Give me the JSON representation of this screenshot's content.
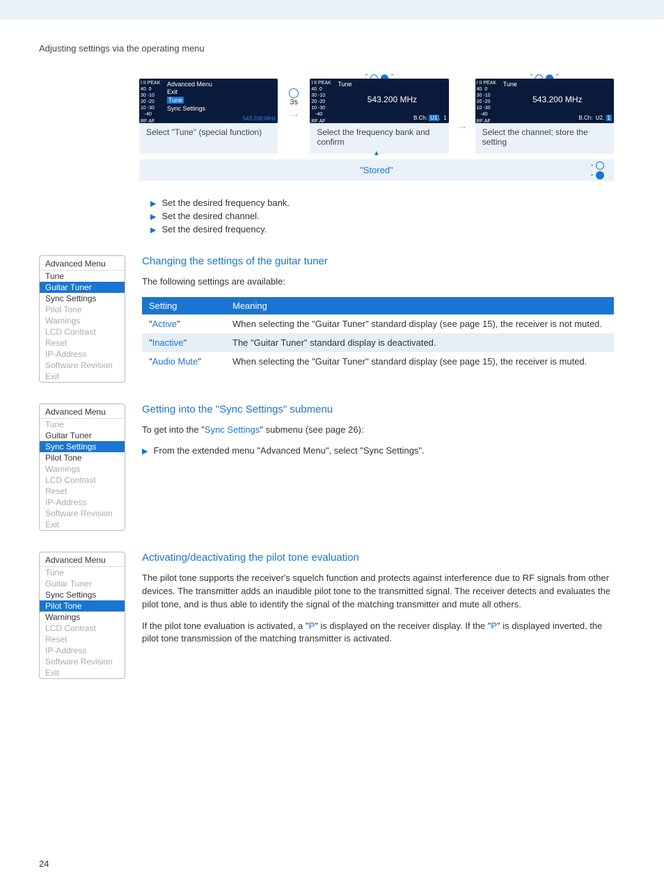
{
  "page_title": "Adjusting settings via the operating menu",
  "page_number": "24",
  "diagram": {
    "lcd1": {
      "title": "Advanced Menu",
      "r1": "Exit",
      "r2": "Tune",
      "r3": "Sync Settings",
      "freq": "543.200 MHz"
    },
    "lcd2": {
      "title": "Tune",
      "freq": "543.200 MHz",
      "bch": "B.Ch: U1.  1"
    },
    "lcd3": {
      "title": "Tune",
      "freq": "543.200 MHz",
      "bch": "B.Ch:  U2. 1"
    },
    "timer": "3s",
    "cap1": "Select \"Tune\" (special function)",
    "cap2": "Select the frequency bank and confirm",
    "cap3": "Select the channel; store the setting",
    "stored": "\"Stored\"",
    "meter_lines": [
      "I  II  PEAK",
      "40   0",
      "30  -10",
      "20  -20",
      "10  -30",
      "     -40",
      "RF | AF"
    ]
  },
  "bullets": [
    "Set the desired frequency bank.",
    "Set the desired channel.",
    "Set the desired frequency."
  ],
  "section1": {
    "heading": "Changing the settings of the guitar tuner",
    "intro": "The following settings are available:",
    "menu_title": "Advanced Menu",
    "menu_items": [
      "Tune",
      "Guitar Tuner",
      "Sync Settings",
      "Pilot Tone",
      "Warnings",
      "LCD Contrast",
      "Reset",
      "IP-Address",
      "Software Revision",
      "Exit"
    ],
    "menu_selected_index": 1,
    "menu_dark": [
      0,
      2
    ],
    "th1": "Setting",
    "th2": "Meaning",
    "rows": [
      {
        "setting": "Active",
        "meaning_before": "When selecting the \"",
        "kw": "Guitar Tuner",
        "meaning_after": "\" standard display (see page 15), the receiver is not muted."
      },
      {
        "setting": "Inactive",
        "meaning_before": "The \"",
        "kw": "Guitar Tuner",
        "meaning_after": "\" standard display is deactivated."
      },
      {
        "setting": "Audio Mute",
        "meaning_before": "When selecting the \"",
        "kw": "Guitar Tuner",
        "meaning_after": "\" standard display (see page 15), the receiver is muted."
      }
    ]
  },
  "section2": {
    "heading": "Getting into the \"Sync Settings\" submenu",
    "line1_before": "To get into the \"",
    "line1_kw": "Sync Settings",
    "line1_after": "\" submenu (see page 26):",
    "step_before": "From the extended menu \"",
    "step_kw1": "Advanced Menu",
    "step_mid": "\", select \"",
    "step_kw2": "Sync Settings",
    "step_after": "\".",
    "menu_title": "Advanced Menu",
    "menu_items": [
      "Tune",
      "Guitar Tuner",
      "Sync Settings",
      "Pilot Tone",
      "Warnings",
      "LCD Contrast",
      "Reset",
      "IP-Address",
      "Software Revision",
      "Exit"
    ],
    "menu_selected_index": 2,
    "menu_dark": [
      1,
      3
    ]
  },
  "section3": {
    "heading": "Activating/deactivating the pilot tone evaluation",
    "p1": "The pilot tone supports the receiver's squelch function and protects against interference due to RF signals from other devices. The transmitter adds an inaudible pilot tone to the transmitted signal. The receiver detects and evaluates the pilot tone, and is thus able to identify the signal of the matching transmitter and mute all others.",
    "p2_before": "If the pilot tone evaluation is activated, a \"",
    "p2_kw1": "P",
    "p2_mid": "\" is displayed on the receiver display. If the \"",
    "p2_kw2": "P",
    "p2_after": "\" is displayed inverted, the pilot tone transmission of the matching transmitter is activated.",
    "menu_title": "Advanced Menu",
    "menu_items": [
      "Tune",
      "Guitar Tuner",
      "Sync Settings",
      "Pilot Tone",
      "Warnings",
      "LCD Contrast",
      "Reset",
      "IP-Address",
      "Software Revision",
      "Exit"
    ],
    "menu_selected_index": 3,
    "menu_dark": [
      2,
      4
    ]
  }
}
